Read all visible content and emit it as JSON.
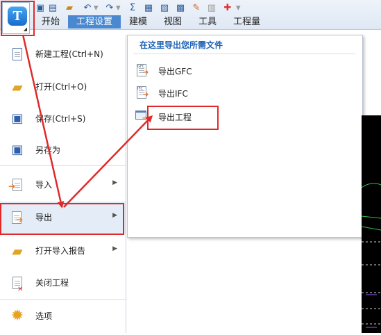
{
  "app": {
    "logo_letter": "T"
  },
  "quick_access": [
    "save-icon",
    "save-all-icon",
    "open-folder-icon",
    "undo-icon",
    "redo-icon",
    "sum-icon",
    "report-icon",
    "search-report-icon",
    "calc-icon",
    "pencil-icon",
    "grid-icon",
    "add-icon",
    "more-icon"
  ],
  "tabs": [
    {
      "label": "开始",
      "active": false
    },
    {
      "label": "工程设置",
      "active": true
    },
    {
      "label": "建模",
      "active": false
    },
    {
      "label": "视图",
      "active": false
    },
    {
      "label": "工具",
      "active": false
    },
    {
      "label": "工程量",
      "active": false
    }
  ],
  "menu": {
    "items": [
      {
        "label": "新建工程(Ctrl+N)",
        "icon": "new-project-icon"
      },
      {
        "label": "打开(Ctrl+O)",
        "icon": "open-folder-icon"
      },
      {
        "label": "保存(Ctrl+S)",
        "icon": "save-icon"
      },
      {
        "label": "另存为",
        "icon": "save-as-icon"
      },
      {
        "label": "导入",
        "icon": "import-icon",
        "submenu": true
      },
      {
        "label": "导出",
        "icon": "export-icon",
        "submenu": true
      },
      {
        "label": "打开导入报告",
        "icon": "open-report-icon",
        "submenu": true
      },
      {
        "label": "关闭工程",
        "icon": "close-project-icon"
      },
      {
        "label": "选项",
        "icon": "gear-icon"
      }
    ]
  },
  "submenu": {
    "title": "在这里导出您所需文件",
    "items": [
      {
        "label": "导出GFC",
        "icon": "export-gfc-icon",
        "icon_text": "GFC"
      },
      {
        "label": "导出IFC",
        "icon": "export-ifc-icon",
        "icon_text": "IFC"
      },
      {
        "label": "导出工程",
        "icon": "export-project-icon"
      }
    ]
  },
  "colors": {
    "accent": "#4a89d0",
    "title_blue": "#1d62b5",
    "annotation_red": "#e02a2a"
  }
}
